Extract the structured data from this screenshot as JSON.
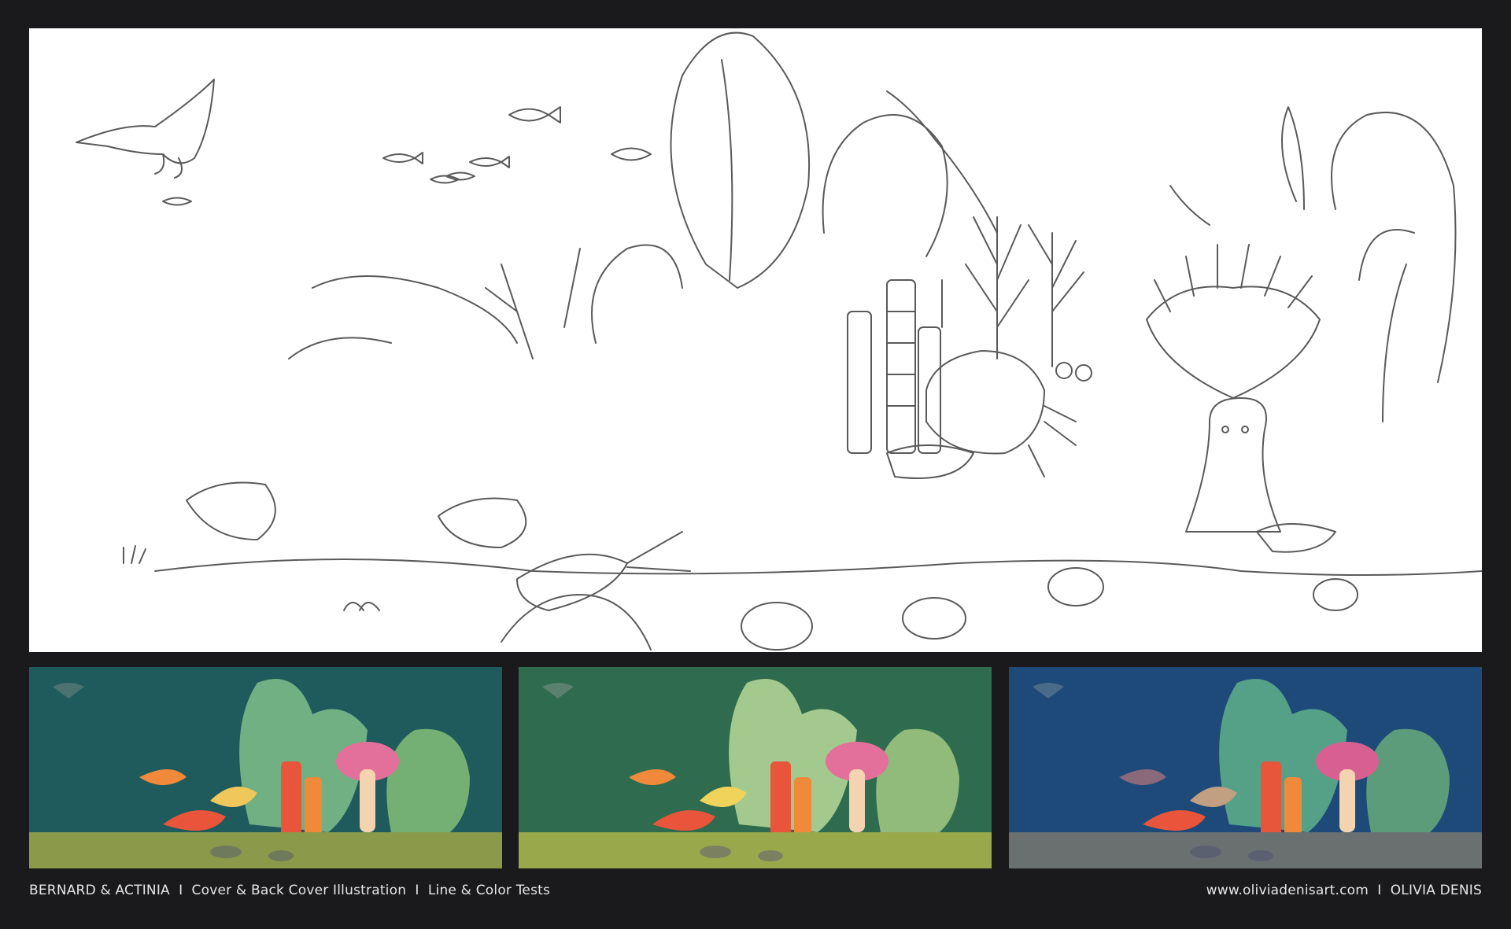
{
  "footer": {
    "project_title": "BERNARD & ACTINIA",
    "description": "Cover & Back Cover Illustration",
    "subtitle": "Line & Color Tests",
    "separator": "I",
    "website": "www.oliviadenisart.com",
    "artist": "OLIVIA DENIS"
  },
  "palette": {
    "page_background": "#1a1a1c",
    "line_art_background": "#ffffff",
    "sketch_stroke": "#5a5a5a",
    "variant_teal": "#1f5a5c",
    "variant_green": "#2f6b4e",
    "variant_blue": "#1e4a7a",
    "coral_red": "#e8553a",
    "coral_orange": "#f08a3a",
    "kelp_green": "#9fd18a",
    "coral_pink": "#e2709a",
    "sand": "#8a9a4a"
  },
  "panels": [
    {
      "name": "line-art",
      "kind": "pencil line drawing"
    },
    {
      "name": "color-test-teal",
      "kind": "color test"
    },
    {
      "name": "color-test-green",
      "kind": "color test"
    },
    {
      "name": "color-test-blue",
      "kind": "color test"
    }
  ]
}
